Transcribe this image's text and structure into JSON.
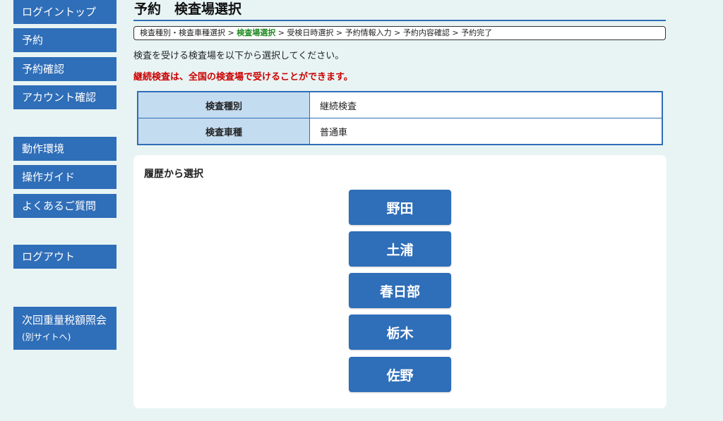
{
  "sidebar": {
    "items": [
      {
        "label": "ログイントップ"
      },
      {
        "label": "予約"
      },
      {
        "label": "予約確認"
      },
      {
        "label": "アカウント確認"
      },
      {
        "label": "動作環境"
      },
      {
        "label": "操作ガイド"
      },
      {
        "label": "よくあるご質問"
      },
      {
        "label": "ログアウト"
      }
    ],
    "tax_link": {
      "label": "次回重量税額照会",
      "sub": "(別サイトへ)"
    }
  },
  "header": {
    "title": "予約　検査場選択"
  },
  "breadcrumb": {
    "steps": [
      "検査種別・検査車種選択",
      "検査場選択",
      "受検日時選択",
      "予約情報入力",
      "予約内容確認",
      "予約完了"
    ],
    "separator": " > "
  },
  "main": {
    "intro": "検査を受ける検査場を以下から選択してください。",
    "warning": "継続検査は、全国の検査場で受けることができます。",
    "info": [
      {
        "label": "検査種別",
        "value": "継続検査"
      },
      {
        "label": "検査車種",
        "value": "普通車"
      }
    ],
    "history": {
      "title": "履歴から選択",
      "sites": [
        "野田",
        "土浦",
        "春日部",
        "栃木",
        "佐野"
      ]
    }
  }
}
